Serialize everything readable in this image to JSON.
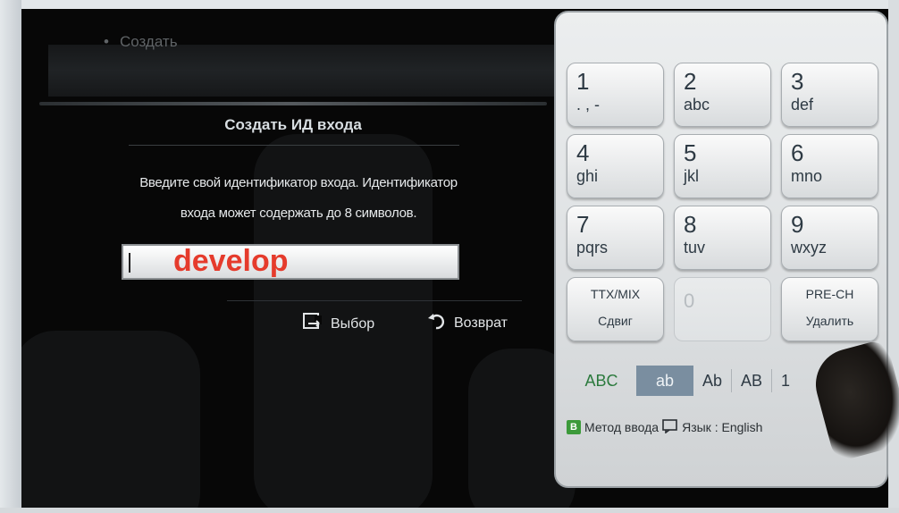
{
  "breadcrumb": {
    "label": "Создать"
  },
  "dialog": {
    "title": "Создать ИД входа",
    "description_line1": "Введите свой идентификатор входа. Идентификатор",
    "description_line2": "входа может содержать до 8 символов.",
    "input_value": "develop",
    "select_label": "Выбор",
    "back_label": "Возврат"
  },
  "keypad": {
    "keys": [
      {
        "num": "1",
        "letters": ". , -"
      },
      {
        "num": "2",
        "letters": "abc"
      },
      {
        "num": "3",
        "letters": "def"
      },
      {
        "num": "4",
        "letters": "ghi"
      },
      {
        "num": "5",
        "letters": "jkl"
      },
      {
        "num": "6",
        "letters": "mno"
      },
      {
        "num": "7",
        "letters": "pqrs"
      },
      {
        "num": "8",
        "letters": "tuv"
      },
      {
        "num": "9",
        "letters": "wxyz"
      }
    ],
    "ttx_top": "TTX/MIX",
    "ttx_bottom": "Сдвиг",
    "zero": "0",
    "prech_top": "PRE-CH",
    "prech_bottom": "Удалить",
    "modes": [
      "ABC",
      "ab",
      "Ab",
      "AB",
      "1"
    ],
    "selected_mode": "ab",
    "input_method_badge": "B",
    "input_method_label": "Метод ввода",
    "language_label": "Язык : English"
  },
  "colors": {
    "input_text": "#e53b2c",
    "abc_mode": "#2b7a3d",
    "selected_mode_bg": "#7a8ea0",
    "badge_green": "#3c9a3a"
  }
}
